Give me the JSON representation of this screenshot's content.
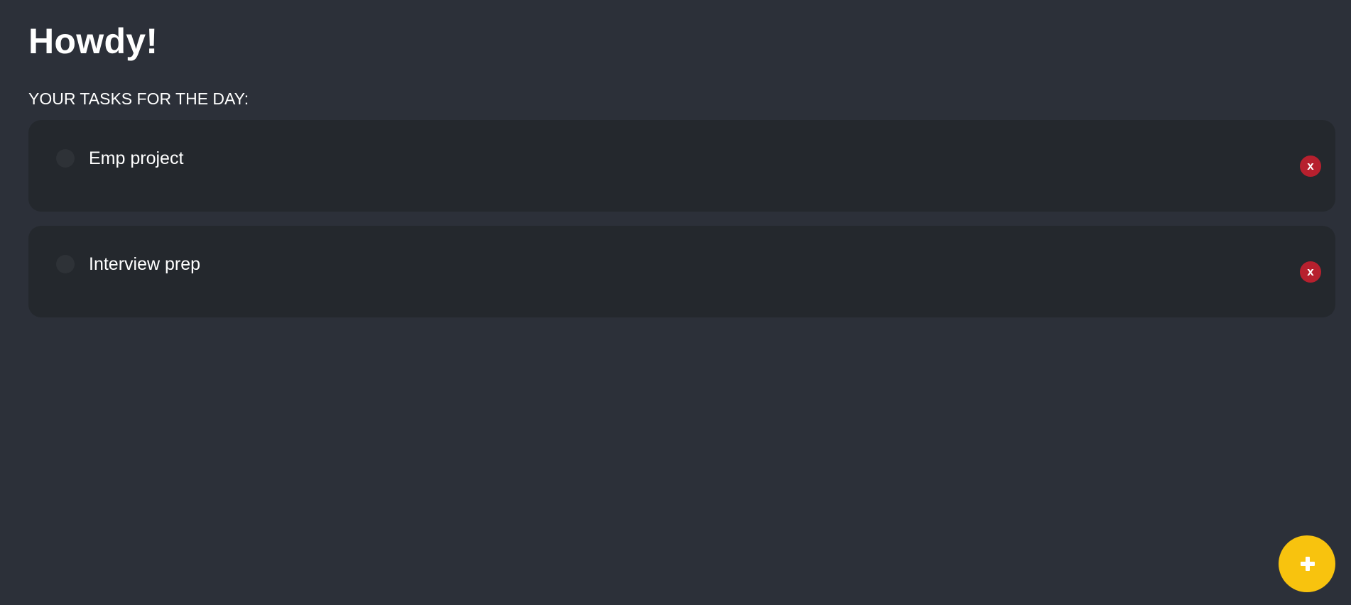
{
  "header": {
    "greeting": "Howdy!"
  },
  "tasks_section": {
    "title": "YOUR TASKS FOR THE DAY:",
    "items": [
      {
        "label": "Emp project",
        "completed": false,
        "delete_label": "x"
      },
      {
        "label": "Interview prep",
        "completed": false,
        "delete_label": "x"
      }
    ]
  },
  "add_button": {
    "icon": "plus-icon"
  },
  "colors": {
    "background": "#2c3039",
    "card_background": "#24282d",
    "delete_button": "#b7202e",
    "add_button": "#f8c30e",
    "text": "#ffffff"
  }
}
